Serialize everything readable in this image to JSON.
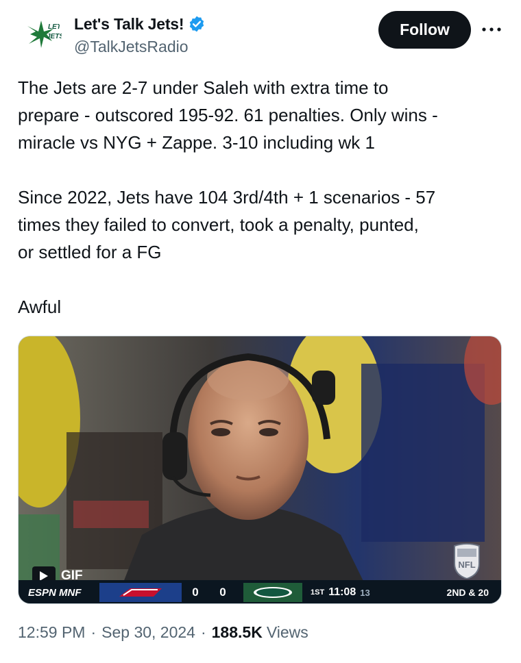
{
  "author": {
    "display_name": "Let's Talk Jets!",
    "handle": "@TalkJetsRadio",
    "avatar_icon": "jets-logo-icon",
    "verified_icon": "verified-badge-icon",
    "verified_color": "#1d9bf0",
    "avatar_text_top": "LET'S",
    "avatar_text_bottom": "JETS"
  },
  "actions": {
    "follow_label": "Follow",
    "more_icon": "more-dots-icon"
  },
  "tweet": {
    "lines_block1": [
      "The Jets are 2-7 under Saleh with extra time to",
      "prepare - outscored 195-92. 61 penalties. Only wins -",
      "miracle vs NYG + Zappe. 3-10 including wk 1"
    ],
    "lines_block2": [
      "Since 2022, Jets have 104 3rd/4th + 1 scenarios - 57",
      "times they failed to convert, took a penalty, punted,",
      "or settled for a FG"
    ],
    "line_block3": "Awful"
  },
  "media": {
    "type": "GIF",
    "gif_label": "GIF",
    "play_icon": "play-icon",
    "scoreboard": {
      "network": "ESPN MNF",
      "team1_logo": "bills-logo-icon",
      "team1_score": "0",
      "team2_score": "0",
      "team2_logo": "jets-logo-icon",
      "quarter": "1ST",
      "clock": "11:08",
      "play_clock": "13",
      "down_distance": "2ND & 20"
    },
    "nfl_logo_icon": "nfl-shield-icon"
  },
  "meta": {
    "time": "12:59 PM",
    "date": "Sep 30, 2024",
    "separator": "·",
    "views_count": "188.5K",
    "views_label": "Views"
  },
  "colors": {
    "text_primary": "#0f1419",
    "text_secondary": "#536471",
    "follow_bg": "#0f1419",
    "jets_green": "#125740"
  }
}
